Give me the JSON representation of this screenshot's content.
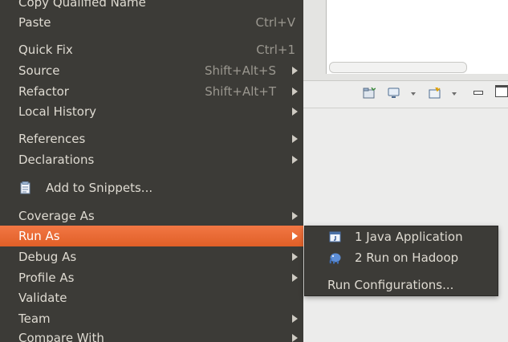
{
  "context_menu": {
    "items": [
      {
        "label": "Copy Qualified Name"
      },
      {
        "label": "Paste",
        "shortcut": "Ctrl+V"
      },
      {
        "label": "Quick Fix",
        "shortcut": "Ctrl+1"
      },
      {
        "label": "Source",
        "shortcut": "Shift+Alt+S"
      },
      {
        "label": "Refactor",
        "shortcut": "Shift+Alt+T"
      },
      {
        "label": "Local History"
      },
      {
        "label": "References"
      },
      {
        "label": "Declarations"
      },
      {
        "label": "Add to Snippets...",
        "icon": "snippet-icon"
      },
      {
        "label": "Coverage As"
      },
      {
        "label": "Run As"
      },
      {
        "label": "Debug As"
      },
      {
        "label": "Profile As"
      },
      {
        "label": "Validate"
      },
      {
        "label": "Team"
      },
      {
        "label": "Compare With"
      }
    ]
  },
  "run_as_submenu": {
    "items": [
      {
        "label": "1 Java Application",
        "icon": "java-application-icon"
      },
      {
        "label": "2 Run on Hadoop",
        "icon": "hadoop-elephant-icon"
      },
      {
        "label": "Run Configurations..."
      }
    ]
  },
  "colors": {
    "menu_bg": "#3c3b37",
    "menu_text": "#dfdbd2",
    "highlight": "#f07746",
    "shortcut_text": "#9a978f"
  }
}
